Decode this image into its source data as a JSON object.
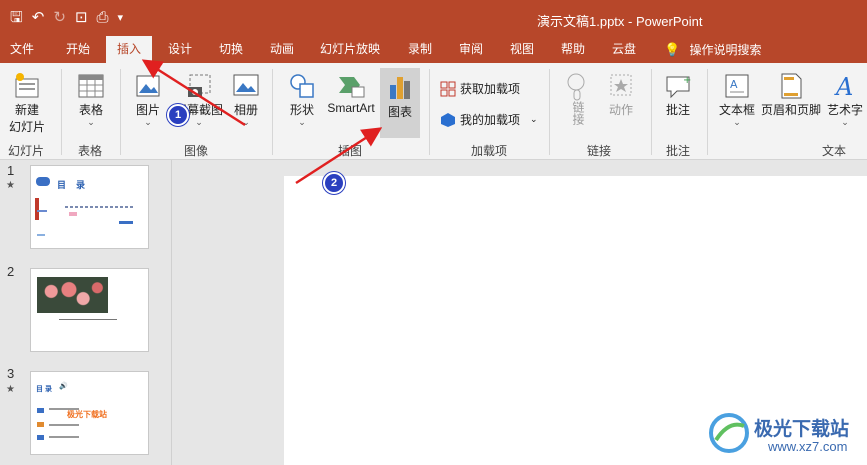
{
  "titlebar": {
    "title": "演示文稿1.pptx  -  PowerPoint"
  },
  "menu": {
    "tabs": [
      "文件",
      "开始",
      "插入",
      "设计",
      "切换",
      "动画",
      "幻灯片放映",
      "录制",
      "审阅",
      "视图",
      "帮助",
      "云盘"
    ],
    "active_tab": "插入",
    "search": "操作说明搜索"
  },
  "ribbon": {
    "new_slide": "新建\n幻灯片",
    "new_slide_l1": "新建",
    "new_slide_l2": "幻灯片",
    "table": "表格",
    "picture": "图片",
    "screenshot": "屏幕截图",
    "album": "相册",
    "shapes": "形状",
    "smartart": "SmartArt",
    "chart": "图表",
    "get_addins": "获取加载项",
    "my_addins": "我的加载项",
    "link": "链接",
    "action": "动作",
    "comment": "批注",
    "textbox": "文本框",
    "header_footer": "页眉和页脚",
    "wordart": "艺术字",
    "groups": {
      "slides": "幻灯片",
      "tables": "表格",
      "images": "图像",
      "illustrations": "插图",
      "addins": "加载项",
      "links": "链接",
      "comments": "批注",
      "text": "文本"
    }
  },
  "slides": [
    {
      "number": "1",
      "starred": true,
      "title": "目    录"
    },
    {
      "number": "2",
      "starred": false
    },
    {
      "number": "3",
      "starred": true,
      "title": "目 录",
      "text": "极光下载站"
    }
  ],
  "annotations": [
    "1",
    "2"
  ],
  "watermark": {
    "text": "极光下载站",
    "url": "www.xz7.com"
  },
  "colors": {
    "accent": "#b7472a",
    "marker": "#2a3fbf",
    "arrow": "#e02020"
  }
}
